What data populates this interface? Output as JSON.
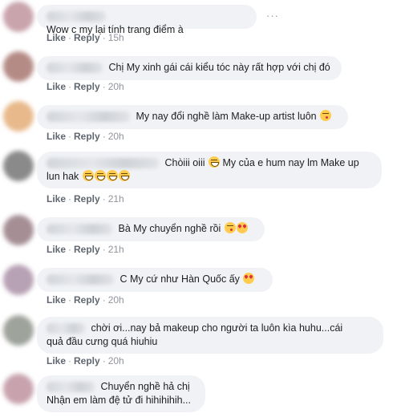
{
  "actions": {
    "like": "Like",
    "reply": "Reply"
  },
  "comments": [
    {
      "text": "Wow c my lại tính trang điểm à",
      "emojis": [],
      "time": "15h",
      "avatar_color": "#c9a4ad"
    },
    {
      "text": "Chị My xinh gái cái kiểu tóc này rất hợp với chị đó",
      "emojis": [],
      "time": "20h",
      "avatar_color": "#b58b86"
    },
    {
      "text": "My nay đổi nghề làm Make-up artist luôn",
      "emojis": [
        "kiss"
      ],
      "time": "20h",
      "avatar_color": "#e8b98b"
    },
    {
      "text": "Chòiii oiii",
      "line1_tail": "My của e hum nay lm Make up",
      "line2": "lun hak",
      "emojis_mid": [
        "grin"
      ],
      "emojis": [
        "grin",
        "grin",
        "grin",
        "grin"
      ],
      "time": "21h",
      "avatar_color": "#8a8a8a"
    },
    {
      "text": "Bà My chuyển nghề rồi",
      "emojis": [
        "kiss",
        "heart-eyes"
      ],
      "time": "21h",
      "avatar_color": "#a58f95"
    },
    {
      "text": "C My cứ như Hàn Quốc ấy",
      "emojis": [
        "heart-eyes"
      ],
      "time": "20h",
      "avatar_color": "#b7a1b4"
    },
    {
      "text": "chời ơi...nay bả makeup cho người ta luôn kìa huhu...cái",
      "line2": "quả đầu cưng quá hiuhiu",
      "emojis": [],
      "time": "20h",
      "avatar_color": "#9ea39b"
    },
    {
      "text": "Chuyển nghề hả chị",
      "line2": "Nhận em làm đệ tử đi hihihihih...",
      "emojis": [],
      "time": "",
      "avatar_color": "#c8a3ae"
    }
  ]
}
